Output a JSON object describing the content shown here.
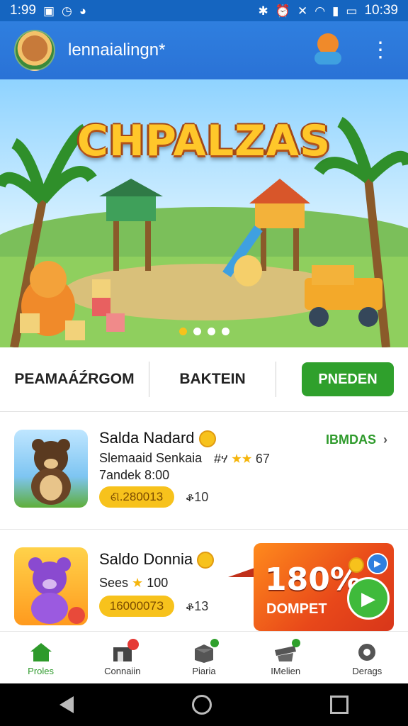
{
  "status_bar": {
    "left_time": "1:99",
    "clock": "10:39",
    "icons_left": [
      "image-icon",
      "timer-icon",
      "circle-icon"
    ],
    "icons_right": [
      "bluetooth-icon",
      "alarm-icon",
      "mute-icon",
      "wifi-icon",
      "signal-icon",
      "battery-icon"
    ]
  },
  "app_bar": {
    "title": "lennaialingn*",
    "avatar_icon": "bear-avatar-icon",
    "mascot_icon": "mascot-icon",
    "menu_icon": "more-vertical-icon",
    "color": "#2a72d6"
  },
  "banner": {
    "title": "CHPALZAS",
    "slide_count": 4,
    "active_slide": 1
  },
  "tabs": {
    "tab1": "PEAMAÁŹRGOM",
    "tab2": "BAKTEIN",
    "button": "PNEDEN",
    "button_color": "#2fa02c"
  },
  "cards": [
    {
      "title": "Salda Nadard",
      "subtitle": "Slemaaid Senkaia",
      "time": "7andek 8:00",
      "rating_prefix": "#ሃ",
      "stars": "★★",
      "rating_value": "67",
      "pill": "ଣ.280013",
      "pill_note": "ቆ10",
      "link": "IBMDAS",
      "thumb_icon": "bear-game-icon"
    },
    {
      "title": "Saldo Donnia",
      "subtitle_prefix": "Sees",
      "star": "★",
      "subtitle_value": "100",
      "pill": "1600007З",
      "pill_note": "ቆ13",
      "thumb_icon": "purple-bear-game-icon",
      "promo": {
        "percent": "180%",
        "label": "DOMPET"
      }
    }
  ],
  "bottom_nav": [
    {
      "label": "Proles",
      "icon": "home-icon",
      "active": true
    },
    {
      "label": "Connaiin",
      "icon": "store-icon",
      "active": false
    },
    {
      "label": "Piaria",
      "icon": "box-icon",
      "active": false
    },
    {
      "label": "IMelien",
      "icon": "gift-icon",
      "active": false
    },
    {
      "label": "Derags",
      "icon": "settings-icon",
      "active": false
    }
  ],
  "accent": {
    "primary_blue": "#2a72d6",
    "green": "#2fa02c",
    "yellow": "#f7c21c"
  }
}
